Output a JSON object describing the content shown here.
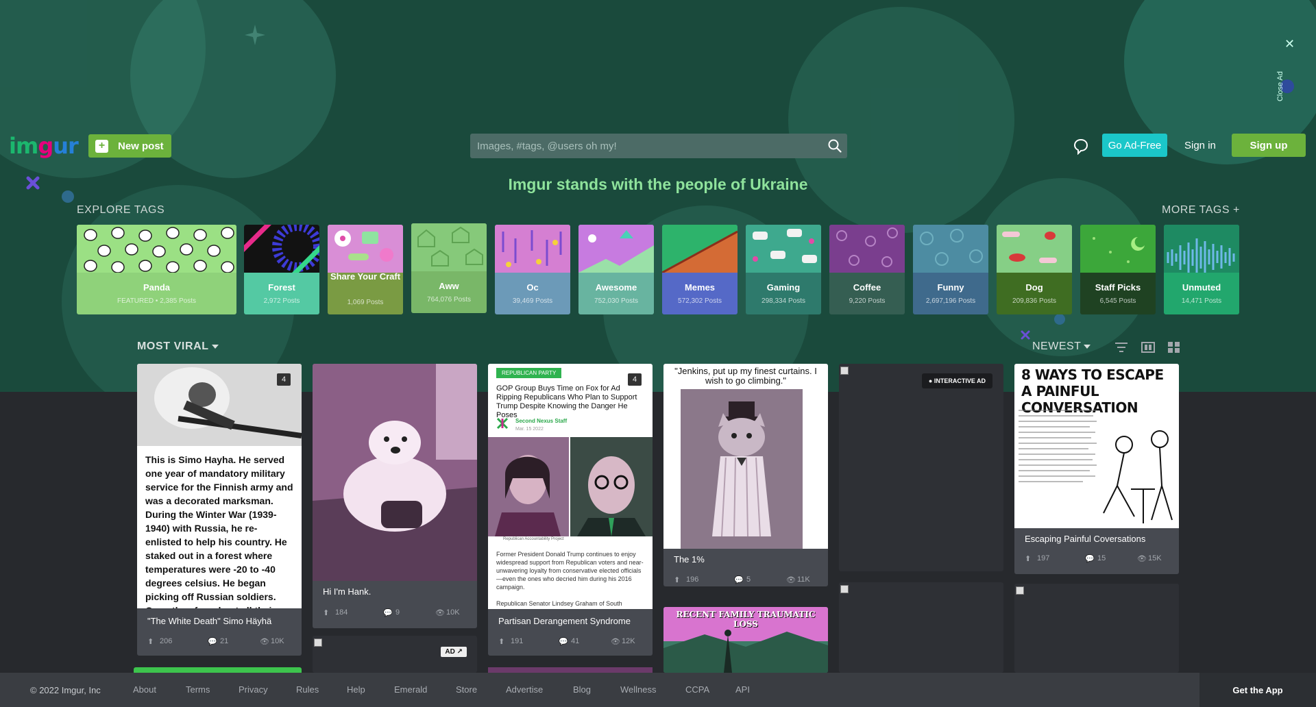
{
  "ad": {
    "close_label": "Close Ad"
  },
  "header": {
    "logo": [
      "im",
      "g",
      "ur"
    ],
    "new_post_label": "New post",
    "search_placeholder": "Images, #tags, @users oh my!",
    "go_adfree_label": "Go Ad-Free",
    "signin_label": "Sign in",
    "signup_label": "Sign up"
  },
  "banner": {
    "text": "Imgur stands with the people of Ukraine"
  },
  "explore": {
    "label": "EXPLORE TAGS",
    "more_label": "MORE TAGS +",
    "tags": [
      {
        "name": "Panda",
        "count": "FEATURED • 2,385 Posts",
        "color": "#8fd27a",
        "art": "#9be084"
      },
      {
        "name": "Forest",
        "count": "2,972 Posts",
        "color": "#54c9a3",
        "art": "#121212"
      },
      {
        "name": "Share Your Craft",
        "count": "1,069 Posts",
        "color": "#7a9b43",
        "art": "#d98ed6"
      },
      {
        "name": "Aww",
        "count": "764,076 Posts",
        "color": "#79b768",
        "art": "#86c97a"
      },
      {
        "name": "Oc",
        "count": "39,469 Posts",
        "color": "#6c9ab8",
        "art": "#d57fd2"
      },
      {
        "name": "Awesome",
        "count": "752,030 Posts",
        "color": "#68b4a0",
        "art": "#c77be0"
      },
      {
        "name": "Memes",
        "count": "572,302 Posts",
        "color": "#5569c7",
        "art": "#d46b35"
      },
      {
        "name": "Gaming",
        "count": "298,334 Posts",
        "color": "#2e7a6c",
        "art": "#3ea98e"
      },
      {
        "name": "Coffee",
        "count": "9,220 Posts",
        "color": "#355e52",
        "art": "#7a3e8e"
      },
      {
        "name": "Funny",
        "count": "2,697,196 Posts",
        "color": "#3f6a8c",
        "art": "#4d8ca2"
      },
      {
        "name": "Dog",
        "count": "209,836 Posts",
        "color": "#3f6d22",
        "art": "#86cf86"
      },
      {
        "name": "Staff Picks",
        "count": "6,545 Posts",
        "color": "#1f4222",
        "art": "#3ca73a"
      },
      {
        "name": "Unmuted",
        "count": "14,471 Posts",
        "color": "#22a76d",
        "art": "#1e8a62"
      }
    ]
  },
  "feed": {
    "sort_label": "MOST VIRAL",
    "order_label": "NEWEST",
    "posts": [
      {
        "title": "\"The White Death\" Simo Häyhä",
        "count": "4",
        "upvotes": "206",
        "comments": "21",
        "views": "10K",
        "text": "This is Simo Hayha. He served one year of mandatory military service for the Finnish army and was a decorated marksman. During the Winter War (1939-1940) with Russia, he re-enlisted to help his country. He staked out in a forest where temperatures were -20 to -40 degrees celsius. He began picking off Russian soldiers. Once they found out all their"
      },
      {
        "title": "Hi I'm Hank.",
        "upvotes": "184",
        "comments": "9",
        "views": "10K"
      },
      {
        "title": "Partisan Derangement Syndrome",
        "count": "4",
        "upvotes": "191",
        "comments": "41",
        "views": "12K",
        "party_tag": "REPUBLICAN PARTY",
        "headline": "GOP Group Buys Time on Fox for Ad Ripping Republicans Who Plan to Support Trump Despite Knowing the Danger He Poses",
        "byline": "Second Nexus Staff",
        "date": "Mar. 15 2022",
        "caption": "Republican Accountability Project",
        "body": "Former President Donald Trump continues to enjoy widespread support from Republican voters and near-unwavering loyalty from conservative elected officials—even the ones who decried him during his 2016 campaign.",
        "body2": "Republican Senator Lindsey Graham of South"
      },
      {
        "title": "The 1%",
        "upvotes": "196",
        "comments": "5",
        "views": "11K",
        "quote": "\"Jenkins, put up my finest curtains. I wish to go climbing.\""
      },
      {
        "title": "Escaping Painful Coversations",
        "upvotes": "197",
        "comments": "15",
        "views": "15K",
        "comic_title": "8 WAYS TO ESCAPE A PAINFUL CONVERSATION"
      }
    ],
    "interactive_ad_label": "INTERACTIVE AD",
    "ad_badge": "AD",
    "zelda_caption": "RECENT FAMILY TRAUMATIC LOSS"
  },
  "footer": {
    "copyright": "© 2022 Imgur, Inc",
    "links": [
      "About",
      "Terms",
      "Privacy",
      "Rules",
      "Help",
      "Emerald",
      "Store",
      "Advertise",
      "Blog",
      "Wellness",
      "CCPA",
      "API"
    ],
    "get_app_label": "Get the App"
  }
}
